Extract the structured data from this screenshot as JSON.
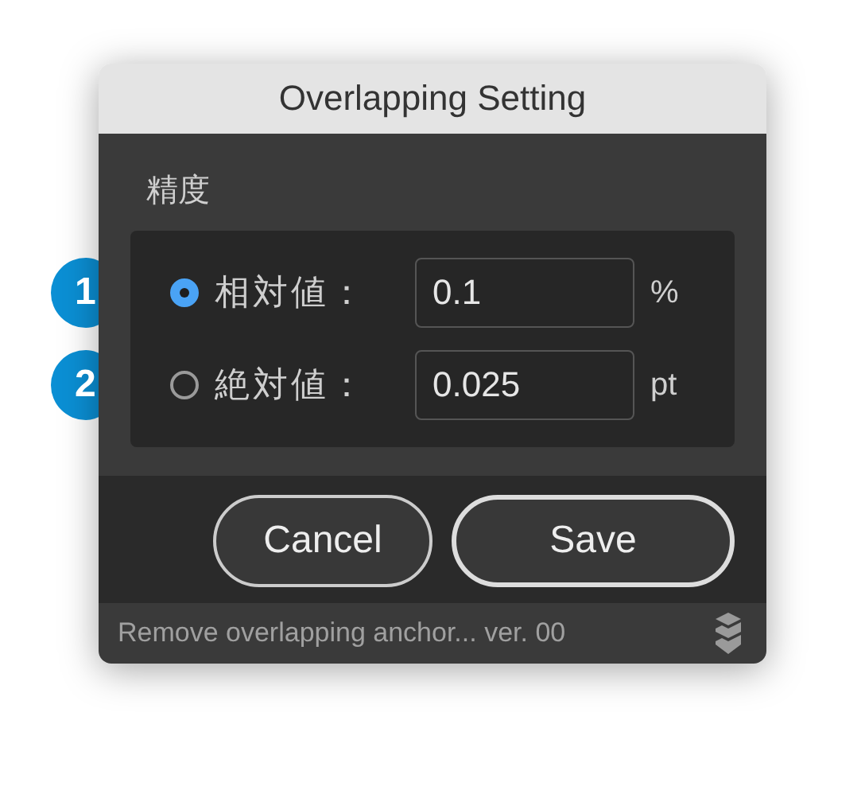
{
  "window": {
    "title": "Overlapping Setting"
  },
  "section_label": "精度",
  "options": [
    {
      "callout": "1",
      "label": "相対値：",
      "selected": true,
      "value": "0.1",
      "unit": "%"
    },
    {
      "callout": "2",
      "label": "絶対値：",
      "selected": false,
      "value": "0.025",
      "unit": "pt"
    }
  ],
  "buttons": [
    {
      "label": "Cancel",
      "kind": "secondary"
    },
    {
      "label": "Save",
      "kind": "primary"
    }
  ],
  "status_bar": {
    "text": "Remove overlapping anchor... ver. 00"
  }
}
